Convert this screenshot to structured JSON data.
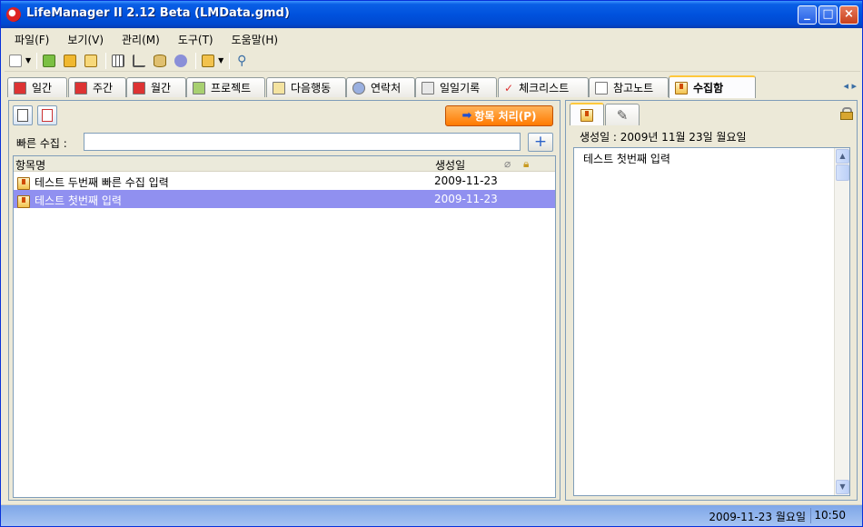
{
  "window": {
    "title": "LifeManager II 2.12 Beta (LMData.gmd)",
    "controls": [
      "minimize",
      "maximize",
      "close"
    ]
  },
  "menu": [
    "파일(F)",
    "보기(V)",
    "관리(M)",
    "도구(T)",
    "도움말(H)"
  ],
  "tabs": [
    {
      "label": "일간",
      "icon": "calendar-day-icon"
    },
    {
      "label": "주간",
      "icon": "calendar-week-icon"
    },
    {
      "label": "월간",
      "icon": "calendar-month-icon"
    },
    {
      "label": "프로젝트",
      "icon": "project-icon"
    },
    {
      "label": "다음행동",
      "icon": "next-action-icon"
    },
    {
      "label": "연락처",
      "icon": "contact-icon"
    },
    {
      "label": "일일기록",
      "icon": "journal-icon"
    },
    {
      "label": "체크리스트",
      "icon": "checklist-icon"
    },
    {
      "label": "참고노트",
      "icon": "note-icon"
    },
    {
      "label": "수집함",
      "icon": "inbox-icon",
      "active": true
    }
  ],
  "left": {
    "process_button": "항목 처리(P)",
    "quick_label": "빠른 수집 :",
    "quick_value": "",
    "add_button": "+",
    "columns": {
      "name": "항목명",
      "created": "생성일"
    },
    "rows": [
      {
        "name": "테스트 두번째 빠른 수집 입력",
        "date": "2009-11-23",
        "selected": false
      },
      {
        "name": "테스트 첫번째 입력",
        "date": "2009-11-23",
        "selected": true
      }
    ]
  },
  "right": {
    "created_info": "생성일 : 2009년 11월 23일 월요일",
    "note_text": "테스트 첫번째 입력"
  },
  "status": {
    "date": "2009-11-23 월요일",
    "time": "10:50"
  }
}
